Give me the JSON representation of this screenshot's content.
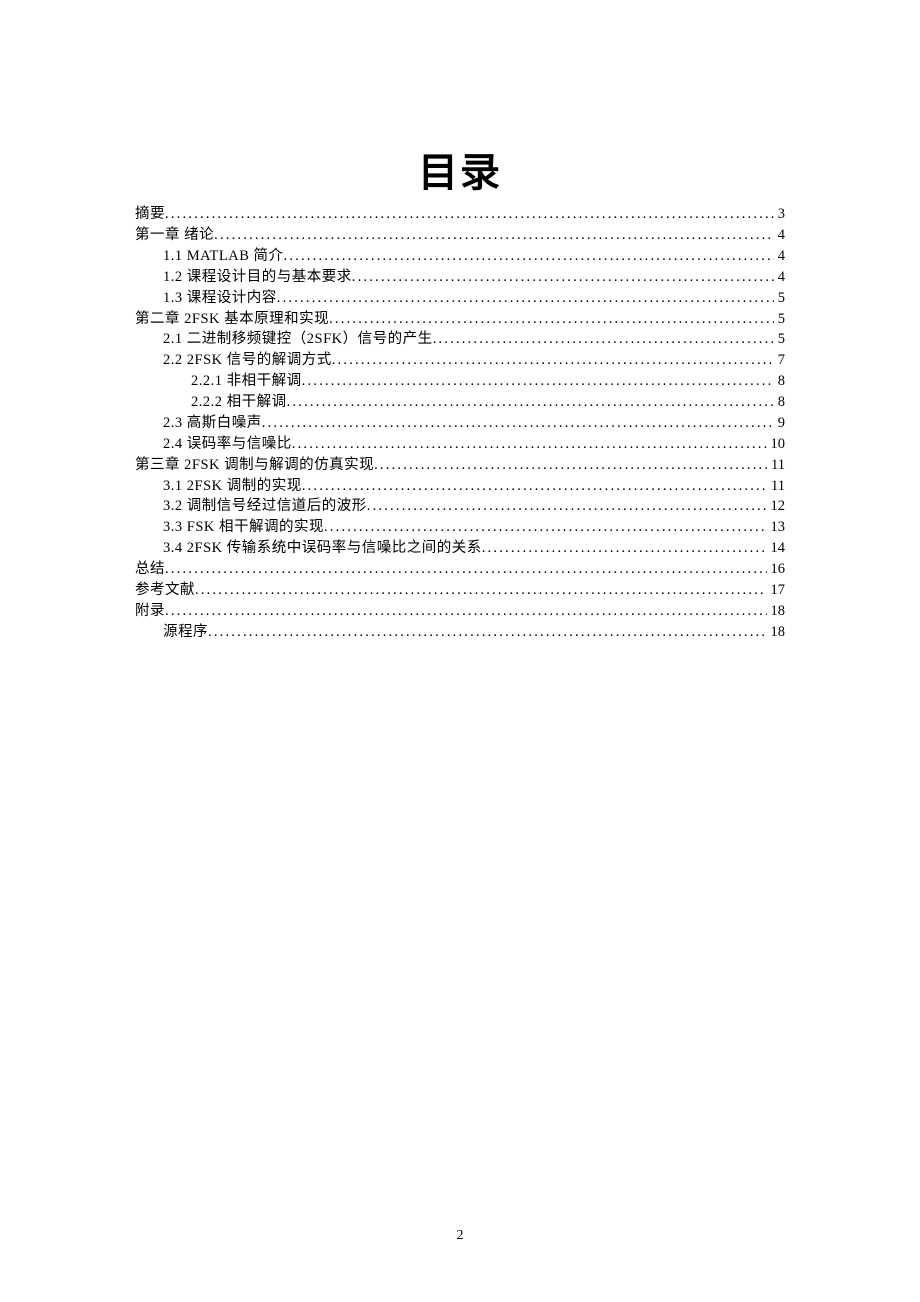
{
  "title": "目录",
  "page_number": "2",
  "toc": [
    {
      "indent": 0,
      "label": "摘要",
      "page": "3"
    },
    {
      "indent": 0,
      "label": "第一章 绪论",
      "page": "4"
    },
    {
      "indent": 1,
      "label": "1.1 MATLAB 简介",
      "page": "4"
    },
    {
      "indent": 1,
      "label": "1.2 课程设计目的与基本要求",
      "page": "4"
    },
    {
      "indent": 1,
      "label": "1.3 课程设计内容",
      "page": "5"
    },
    {
      "indent": 0,
      "label": "第二章 2FSK 基本原理和实现",
      "page": "5"
    },
    {
      "indent": 1,
      "label": "2.1 二进制移频键控（2SFK）信号的产生",
      "page": "5"
    },
    {
      "indent": 1,
      "label": "2.2  2FSK 信号的解调方式",
      "page": "7"
    },
    {
      "indent": 2,
      "label": "2.2.1 非相干解调",
      "page": "8"
    },
    {
      "indent": 2,
      "label": "2.2.2 相干解调",
      "page": "8"
    },
    {
      "indent": 1,
      "label": "2.3 高斯白噪声",
      "page": "9"
    },
    {
      "indent": 1,
      "label": "2.4 误码率与信噪比",
      "page": "10"
    },
    {
      "indent": 0,
      "label": "第三章 2FSK 调制与解调的仿真实现",
      "page": "11"
    },
    {
      "indent": 1,
      "label": "3.1 2FSK 调制的实现",
      "page": "11"
    },
    {
      "indent": 1,
      "label": "3.2 调制信号经过信道后的波形",
      "page": "12"
    },
    {
      "indent": 1,
      "label": "3.3 FSK 相干解调的实现",
      "page": "13"
    },
    {
      "indent": 1,
      "label": "3.4 2FSK 传输系统中误码率与信噪比之间的关系",
      "page": "14"
    },
    {
      "indent": 0,
      "label": "总结",
      "page": "16"
    },
    {
      "indent": 0,
      "label": "参考文献",
      "page": "17"
    },
    {
      "indent": 0,
      "label": "附录",
      "page": "18"
    },
    {
      "indent": 1,
      "label": "源程序",
      "page": "18"
    }
  ]
}
